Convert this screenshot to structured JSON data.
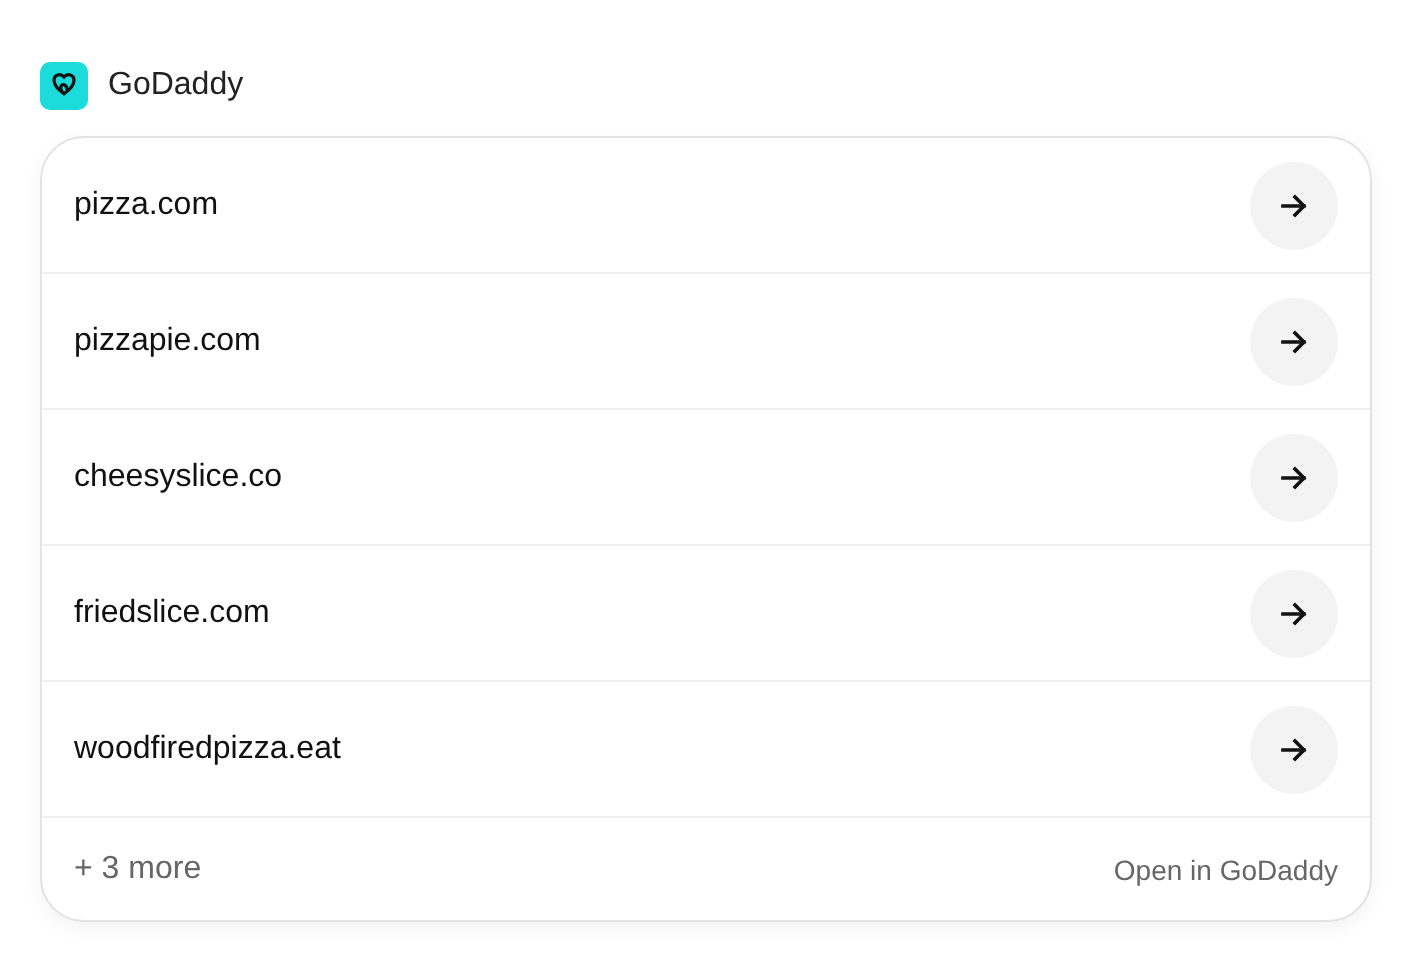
{
  "app": {
    "name": "GoDaddy"
  },
  "domains": [
    {
      "name": "pizza.com"
    },
    {
      "name": "pizzapie.com"
    },
    {
      "name": "cheesyslice.co"
    },
    {
      "name": "friedslice.com"
    },
    {
      "name": "woodfiredpizza.eat"
    }
  ],
  "footer": {
    "more": "+ 3 more",
    "link": "Open in GoDaddy"
  }
}
